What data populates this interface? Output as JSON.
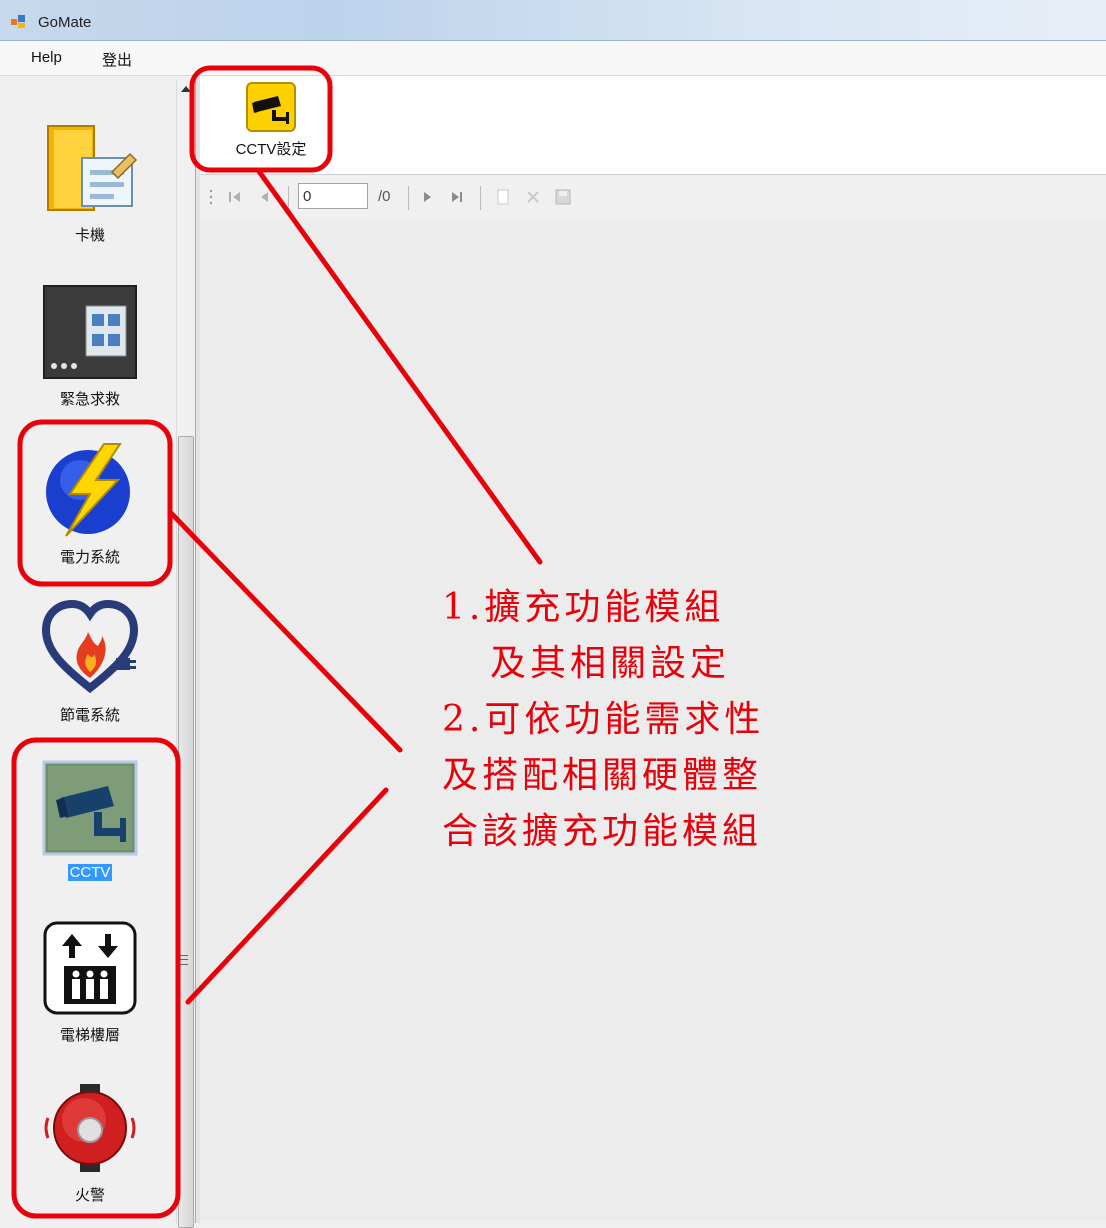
{
  "window": {
    "title": "GoMate"
  },
  "menu": {
    "items": [
      "Help",
      "登出"
    ]
  },
  "sidebar": {
    "items": [
      {
        "label": "卡機",
        "icon": "door-form-icon"
      },
      {
        "label": "緊急求救",
        "icon": "control-panel-icon"
      },
      {
        "label": "電力系統",
        "icon": "lightning-icon"
      },
      {
        "label": "節電系統",
        "icon": "heart-flame-plug-icon"
      },
      {
        "label": "CCTV",
        "icon": "cctv-camera-icon",
        "selected": true
      },
      {
        "label": "電梯樓層",
        "icon": "elevator-icon"
      },
      {
        "label": "火警",
        "icon": "alarm-bell-icon"
      }
    ]
  },
  "toolbar": {
    "cctv_settings_label": "CCTV設定"
  },
  "navigator": {
    "position": "0",
    "count": "/0"
  },
  "annotation": {
    "lines": [
      "1.擴充功能模組",
      "  及其相關設定",
      "2.可依功能需求性",
      "及搭配相關硬體整",
      "合該擴充功能模組"
    ]
  },
  "colors": {
    "annotation": "#e8000a",
    "selection": "#3399ff"
  }
}
